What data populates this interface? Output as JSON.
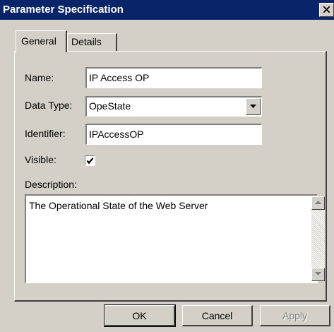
{
  "window": {
    "title": "Parameter Specification"
  },
  "tabs": [
    {
      "label": "General"
    },
    {
      "label": "Details"
    }
  ],
  "form": {
    "name_label": "Name:",
    "name_value": "IP Access OP",
    "data_type_label": "Data Type:",
    "data_type_value": "OpeState",
    "identifier_label": "Identifier:",
    "identifier_value": "IPAccessOP",
    "visible_label": "Visible:",
    "visible_checked": true,
    "description_label": "Description:",
    "description_value": "The Operational State of the Web Server"
  },
  "buttons": {
    "ok": "OK",
    "cancel": "Cancel",
    "apply": "Apply",
    "apply_enabled": false
  },
  "icons": {
    "close": "close-icon",
    "dropdown": "chevron-down-icon",
    "scroll_up": "scroll-up-arrow-icon",
    "scroll_down": "scroll-down-arrow-icon",
    "check": "checkmark-icon"
  }
}
